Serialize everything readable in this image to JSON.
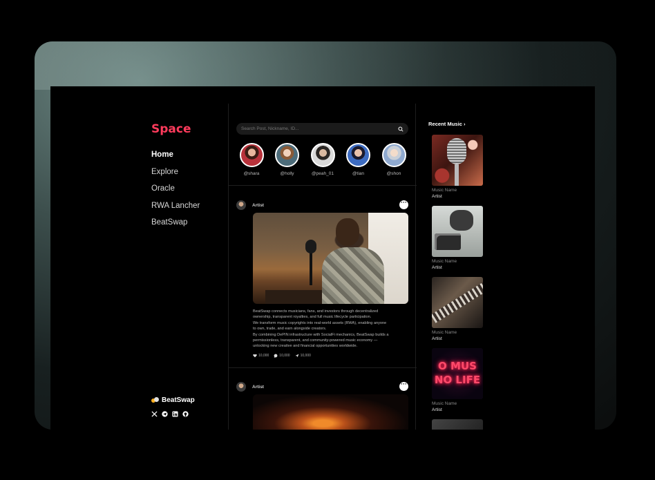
{
  "app": {
    "brand": "Space",
    "nav": [
      {
        "label": "Home",
        "active": true
      },
      {
        "label": "Explore",
        "active": false
      },
      {
        "label": "Oracle",
        "active": false
      },
      {
        "label": "RWA Lancher",
        "active": false
      },
      {
        "label": "BeatSwap",
        "active": false
      }
    ],
    "footer": {
      "brand": "BeatSwap",
      "socials": [
        "x-icon",
        "telegram-icon",
        "linkedin-icon",
        "github-icon"
      ]
    }
  },
  "search": {
    "placeholder": "Search Post, Nickname, ID...",
    "value": ""
  },
  "stories": [
    {
      "handle": "@shara"
    },
    {
      "handle": "@holly"
    },
    {
      "handle": "@peah_01"
    },
    {
      "handle": "@tian"
    },
    {
      "handle": "@shon"
    }
  ],
  "posts": [
    {
      "author": "Artist",
      "text": [
        "BeatSwap connects musicians, fans, and investors through decentralized",
        "ownership, transparent royalties, and full music lifecycle participation.",
        "We transform music copyrights into real-world assets (RWA), enabling anyone",
        "to own, trade, and earn alongside creators.",
        "By combining DePIN infrastructure with SocialFi mechanics, BeatSwap builds a",
        "permissionless, transparent, and community-powered music economy —",
        "unlocking new creative and financial opportunities worldwide."
      ],
      "likes": "10,000",
      "comments": "10,000",
      "shares": "10,000"
    },
    {
      "author": "Artist"
    }
  ],
  "recent_music": {
    "title": "Recent Music ›",
    "items": [
      {
        "name": "Music Name",
        "artist": "Artist"
      },
      {
        "name": "Music Name",
        "artist": "Artist"
      },
      {
        "name": "Music Name",
        "artist": "Artist"
      },
      {
        "name": "Music Name",
        "artist": "Artist",
        "thumb_text": [
          "O MUS",
          "NO LIFE"
        ]
      }
    ]
  },
  "colors": {
    "brand": "#ff3b5c",
    "background": "#000000"
  }
}
